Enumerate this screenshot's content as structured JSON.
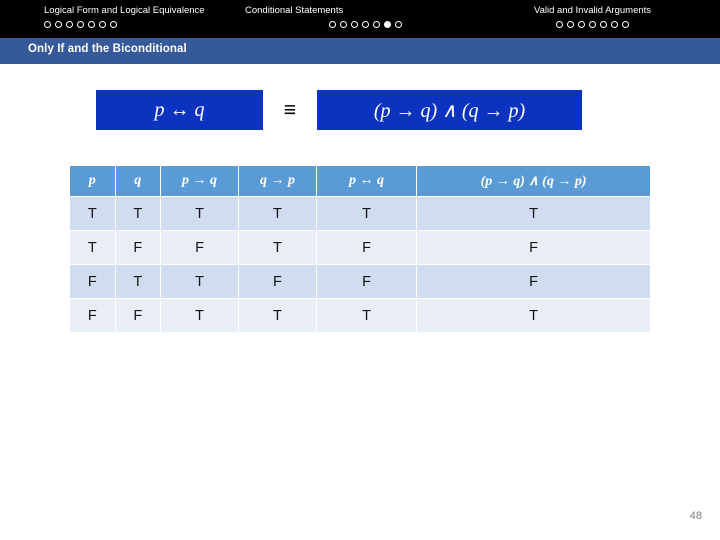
{
  "topnav": {
    "groups": [
      {
        "title": "Logical Form and Logical Equivalence",
        "dots": [
          "hollow",
          "hollow",
          "hollow",
          "hollow",
          "hollow",
          "hollow",
          "hollow"
        ]
      },
      {
        "title": "Conditional Statements",
        "dots": [
          "hollow",
          "hollow",
          "hollow",
          "hollow",
          "hollow",
          "filled",
          "hollow"
        ]
      },
      {
        "title": "Valid and Invalid Arguments",
        "dots": [
          "hollow",
          "hollow",
          "hollow",
          "hollow",
          "hollow",
          "hollow",
          "hollow"
        ]
      }
    ],
    "background_color": "#000000",
    "text_color": "#ffffff"
  },
  "section": {
    "title": "Only If and the Biconditional",
    "background_color": "#36599A",
    "text_color": "#ffffff"
  },
  "formula": {
    "left": "p ↔ q",
    "equiv_symbol": "≡",
    "right": "(p → q) ∧ (q → p)",
    "box_color": "#0C32C0",
    "box_text_color": "#ffffff",
    "equiv_color": "#000000"
  },
  "truth_table": {
    "header_color": "#5B9BD5",
    "row_dark_color": "#D0DCEF",
    "row_light_color": "#E9EDF5",
    "columns": [
      "p",
      "q",
      "p → q",
      "q → p",
      "p ↔ q",
      "(p → q) ∧ (q → p)"
    ],
    "rows": [
      [
        "T",
        "T",
        "T",
        "T",
        "T",
        "T"
      ],
      [
        "T",
        "F",
        "F",
        "T",
        "F",
        "F"
      ],
      [
        "F",
        "T",
        "T",
        "F",
        "F",
        "F"
      ],
      [
        "F",
        "F",
        "T",
        "T",
        "T",
        "T"
      ]
    ]
  },
  "footer": {
    "page_number": "48"
  }
}
